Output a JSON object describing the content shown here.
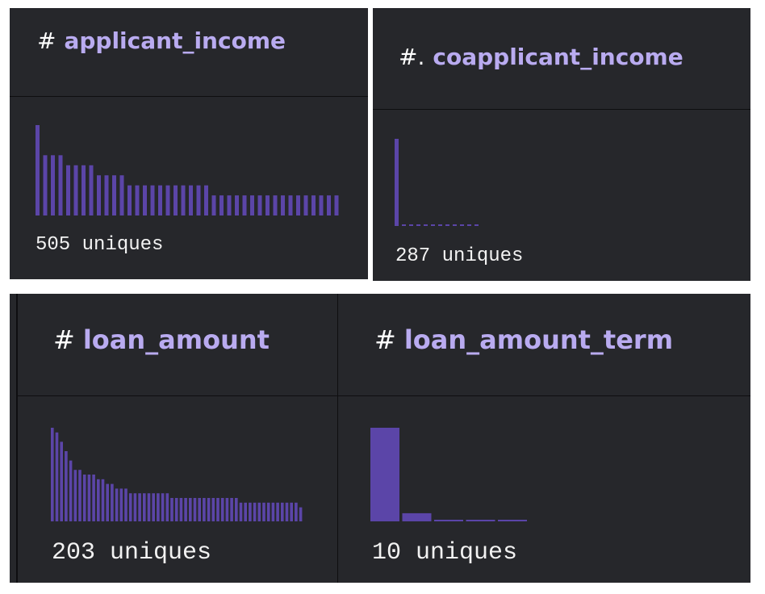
{
  "bar_color": "#5b45a8",
  "panels": [
    {
      "hash": "#",
      "title": "applicant_income",
      "uniques": "505 uniques",
      "chart_data": {
        "type": "bar",
        "values": [
          9,
          6,
          6,
          6,
          5,
          5,
          5,
          5,
          4,
          4,
          4,
          4,
          3,
          3,
          3,
          3,
          3,
          3,
          3,
          3,
          3,
          3,
          3,
          2,
          2,
          2,
          2,
          2,
          2,
          2,
          2,
          2,
          2,
          2,
          2,
          2,
          2,
          2,
          2,
          2
        ],
        "ylim": [
          0,
          9
        ]
      }
    },
    {
      "hash": "#.",
      "title": "coapplicant_income",
      "uniques": "287 uniques",
      "chart_data": {
        "type": "bar",
        "values": [
          100,
          1,
          1,
          1,
          1,
          1,
          1,
          1,
          1,
          1,
          1,
          1
        ],
        "ylim": [
          0,
          100
        ]
      }
    },
    {
      "hash": "#",
      "title": "loan_amount",
      "uniques": "203 uniques",
      "chart_data": {
        "type": "bar",
        "values": [
          20,
          19,
          17,
          15,
          13,
          11,
          11,
          10,
          10,
          10,
          9,
          9,
          8,
          8,
          7,
          7,
          7,
          6,
          6,
          6,
          6,
          6,
          6,
          6,
          6,
          6,
          5,
          5,
          5,
          5,
          5,
          5,
          5,
          5,
          5,
          5,
          5,
          5,
          5,
          5,
          5,
          4,
          4,
          4,
          4,
          4,
          4,
          4,
          4,
          4,
          4,
          4,
          4,
          4,
          3
        ],
        "ylim": [
          0,
          20
        ]
      }
    },
    {
      "hash": "#",
      "title": "loan_amount_term",
      "uniques": "10 uniques",
      "chart_data": {
        "type": "bar",
        "values": [
          115,
          10,
          2,
          2,
          2
        ],
        "ylim": [
          0,
          115
        ]
      }
    }
  ]
}
